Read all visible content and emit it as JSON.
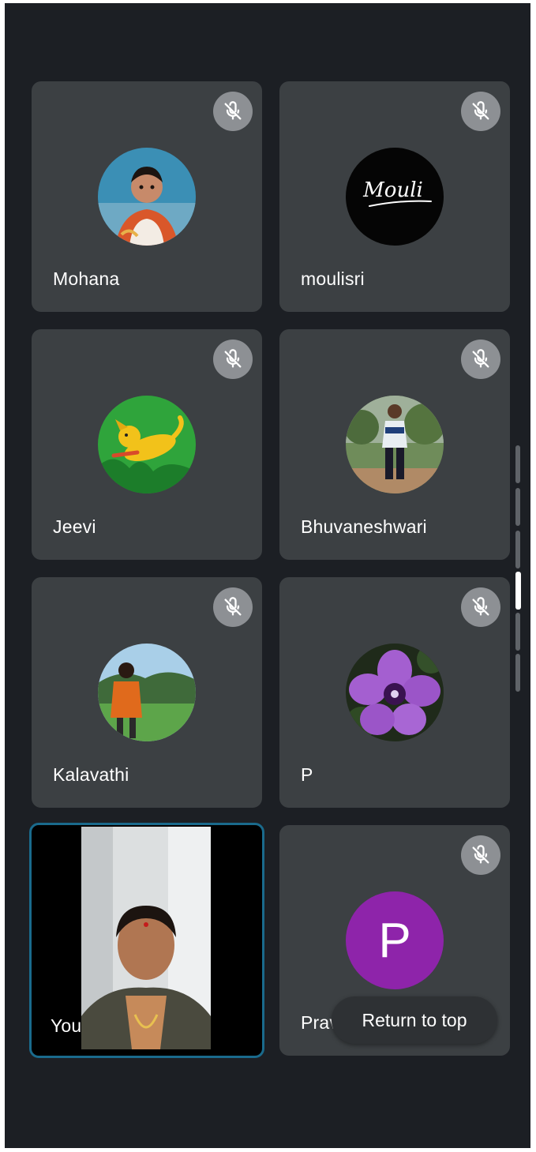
{
  "participants": [
    {
      "name": "Mohana",
      "muted": true,
      "avatar": "baby-photo"
    },
    {
      "name": "moulisri",
      "muted": true,
      "avatar": "signature-logo"
    },
    {
      "name": "Jeevi",
      "muted": true,
      "avatar": "cartoon-dog-illustration"
    },
    {
      "name": "Bhuvaneshwari",
      "muted": true,
      "avatar": "man-standing-outdoors"
    },
    {
      "name": "Kalavathi",
      "muted": true,
      "avatar": "person-in-field"
    },
    {
      "name": "P",
      "muted": true,
      "avatar": "purple-flower"
    },
    {
      "name": "You",
      "muted": false,
      "avatar": "live-video"
    },
    {
      "name": "Prav",
      "muted": true,
      "avatar": "letter",
      "avatar_letter": "P",
      "avatar_color": "#8e24aa"
    }
  ],
  "logo_text": "Mouli",
  "return_to_top": "Return to top",
  "colors": {
    "background": "#1c1f24",
    "tile": "#3c4043",
    "mute_badge": "#8d9094",
    "self_border": "#1a6a8c",
    "letter_avatar": "#8e24aa"
  },
  "icons": {
    "mute": "mic-off-icon"
  },
  "scroll": {
    "segments": 6,
    "active_segment": 4
  }
}
